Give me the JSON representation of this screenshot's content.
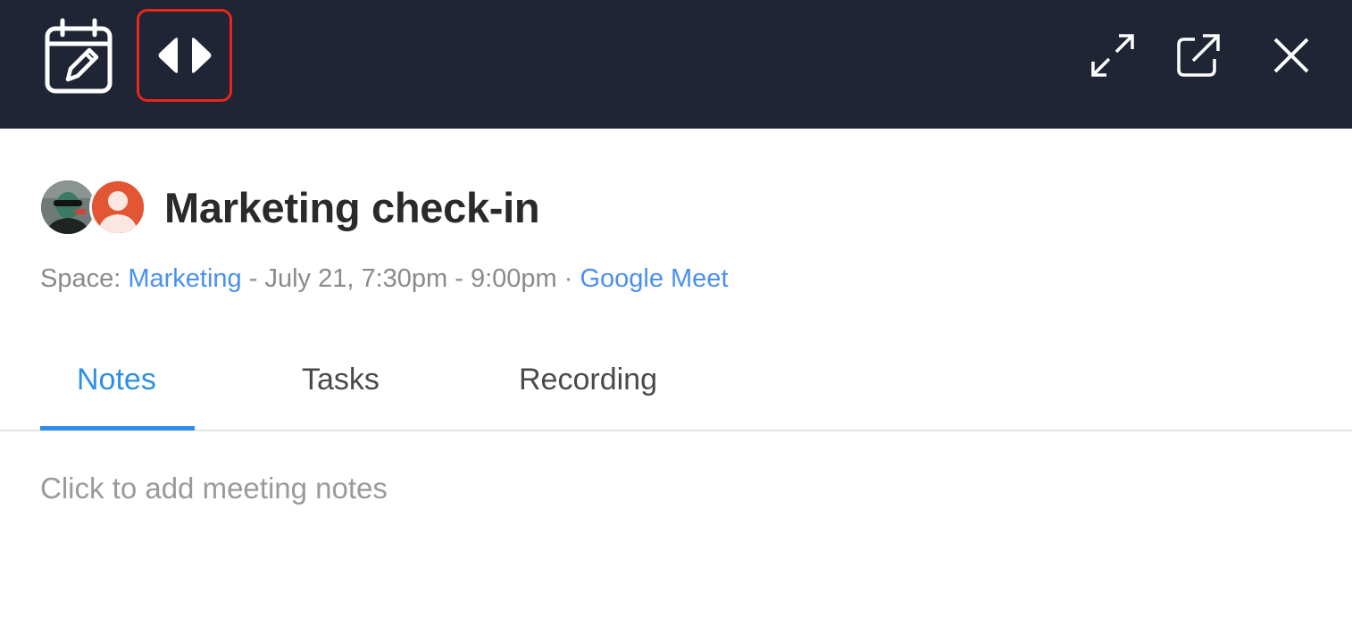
{
  "toolbar": {
    "edit_calendar_icon": "calendar-edit-icon",
    "resize_icon": "resize-horizontal-icon",
    "expand_icon": "expand-icon",
    "popout_icon": "external-link-icon",
    "close_icon": "close-icon",
    "background_color": "#1f2535",
    "highlight_color": "#e8271b"
  },
  "meeting": {
    "title": "Marketing check-in",
    "space_prefix": "Space: ",
    "space_name": "Marketing",
    "datetime": " - July 21, 7:30pm - 9:00pm · ",
    "conference": "Google Meet",
    "link_color": "#4a8ff0"
  },
  "participants": [
    {
      "avatar": "photo-avatar"
    },
    {
      "avatar": "default-user-avatar",
      "color": "#e35633"
    }
  ],
  "tabs": [
    {
      "label": "Notes",
      "active": true
    },
    {
      "label": "Tasks",
      "active": false
    },
    {
      "label": "Recording",
      "active": false
    }
  ],
  "notes": {
    "placeholder": "Click to add meeting notes"
  }
}
